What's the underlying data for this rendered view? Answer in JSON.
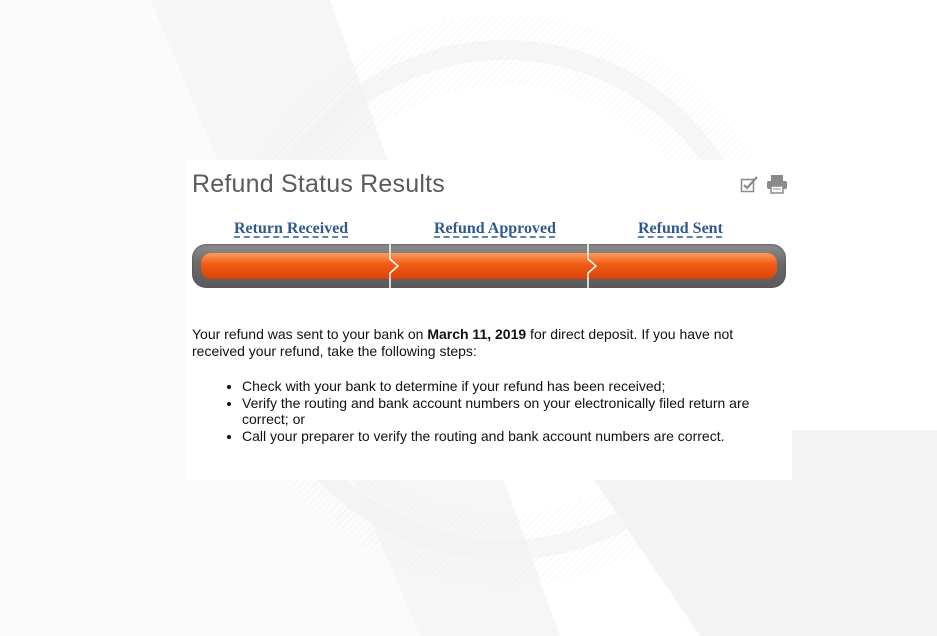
{
  "page": {
    "title": "Refund Status Results",
    "icons": [
      "checkbox-pen-icon",
      "printer-icon"
    ]
  },
  "progress": {
    "steps": [
      {
        "label": "Return Received"
      },
      {
        "label": "Refund Approved"
      },
      {
        "label": "Refund Sent"
      }
    ],
    "completed_steps": 3,
    "total_steps": 3,
    "fill_color": "#f05a14",
    "track_color": "#6e6e6e"
  },
  "message": {
    "pre": "Your refund was sent to your bank on ",
    "date": "March 11, 2019",
    "post": " for direct deposit. If you have not received your refund, take the following steps:"
  },
  "steps": [
    "Check with your bank to determine if your refund has been received;",
    "Verify the routing and bank account numbers on your electronically filed return are correct; or",
    "Call your preparer to verify the routing and bank account numbers are correct."
  ]
}
